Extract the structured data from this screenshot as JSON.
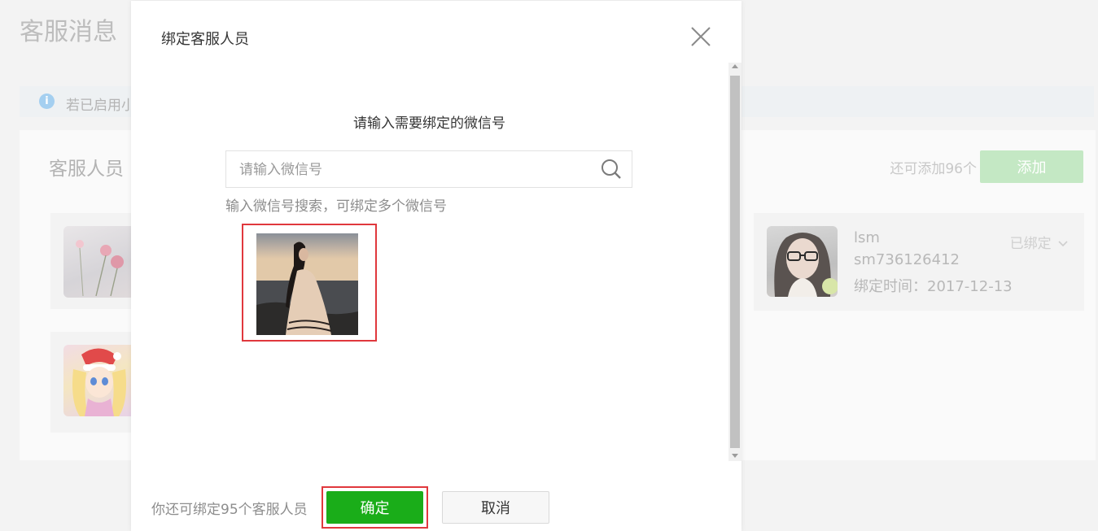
{
  "page": {
    "title": "客服消息",
    "notice_text": "若已启用小",
    "section_title": "客服人员",
    "remaining_text": "还可添加96个",
    "add_label": "添加"
  },
  "cards": {
    "right": {
      "name": "lsm",
      "wechat_id": "sm736126412",
      "bind_time": "绑定时间：2017-12-13",
      "status": "已绑定"
    }
  },
  "modal": {
    "title": "绑定客服人员",
    "prompt": "请输入需要绑定的微信号",
    "search_placeholder": "请输入微信号",
    "search_value": "",
    "hint": "输入微信号搜索，可绑定多个微信号",
    "footer_text": "你还可绑定95个客服人员",
    "confirm_label": "确定",
    "cancel_label": "取消"
  },
  "colors": {
    "accent": "#1aad19",
    "accent_disabled": "#c4e8c4",
    "highlight_border": "#e0383d"
  },
  "icons": [
    "info-icon",
    "close-icon",
    "search-icon",
    "chevron-down-icon"
  ]
}
